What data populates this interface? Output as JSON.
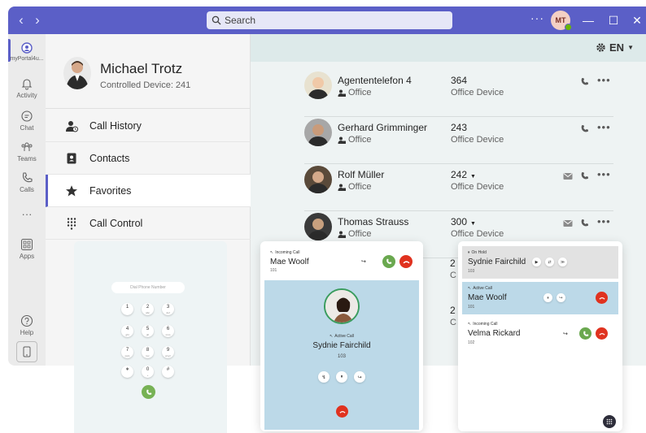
{
  "titlebar": {
    "search_placeholder": "Search",
    "more_label": "···",
    "avatar_initials": "MT",
    "minimize": "—",
    "maximize": "☐",
    "close": "✕"
  },
  "rail": [
    {
      "label": "myPortal4u..."
    },
    {
      "label": "Activity"
    },
    {
      "label": "Chat"
    },
    {
      "label": "Teams"
    },
    {
      "label": "Calls"
    },
    {
      "label": "···"
    },
    {
      "label": "Apps"
    },
    {
      "label": "Help"
    }
  ],
  "profile": {
    "name": "Michael Trotz",
    "device": "Controlled Device:  241"
  },
  "nav": [
    {
      "label": "Call History"
    },
    {
      "label": "Contacts"
    },
    {
      "label": "Favorites"
    },
    {
      "label": "Call Control"
    }
  ],
  "header": {
    "language": "EN"
  },
  "favorites": [
    {
      "name": "Agententelefon 4",
      "location": "Office",
      "number": "364",
      "type": "Office Device",
      "dropdown": false,
      "mail": false
    },
    {
      "name": "Gerhard Grimminger",
      "location": "Office",
      "number": "243",
      "type": "Office Device",
      "dropdown": false,
      "mail": false
    },
    {
      "name": "Rolf Müller",
      "location": "Office",
      "number": "242",
      "type": "Office Device",
      "dropdown": true,
      "mail": true
    },
    {
      "name": "Thomas Strauss",
      "location": "Office",
      "number": "300",
      "type": "Office Device",
      "dropdown": true,
      "mail": true
    }
  ],
  "hidden_rows": {
    "n1": "2",
    "c1": "C",
    "n2": "2",
    "c2": "C"
  },
  "dialpad": {
    "placeholder": "Dial Phone Number",
    "keys": [
      {
        "d": "1",
        "s": ""
      },
      {
        "d": "2",
        "s": "abc"
      },
      {
        "d": "3",
        "s": "def"
      },
      {
        "d": "4",
        "s": "ghi"
      },
      {
        "d": "5",
        "s": "jkl"
      },
      {
        "d": "6",
        "s": "mno"
      },
      {
        "d": "7",
        "s": "pqrs"
      },
      {
        "d": "8",
        "s": "tuv"
      },
      {
        "d": "9",
        "s": "wxyz"
      },
      {
        "d": "∗",
        "s": ""
      },
      {
        "d": "0",
        "s": "+"
      },
      {
        "d": "#",
        "s": ""
      }
    ]
  },
  "call_card": {
    "incoming_label": "Incoming Call",
    "incoming_name": "Mae Woolf",
    "incoming_number": "101",
    "active_label": "Active Call",
    "active_name": "Sydnie Fairchild",
    "active_number": "103"
  },
  "list_card": {
    "hold_label": "On Hold",
    "hold_name": "Sydnie Fairchild",
    "hold_number": "103",
    "active_label": "Active Call",
    "active_name": "Mae Woolf",
    "active_number": "101",
    "incoming_label": "Incoming Call",
    "incoming_name": "Velma Rickard",
    "incoming_number": "102"
  },
  "colors": {
    "brand": "#5b5fc7",
    "accept": "#6aa84f",
    "decline": "#e0321f",
    "active_call_bg": "#bcd9e8"
  }
}
